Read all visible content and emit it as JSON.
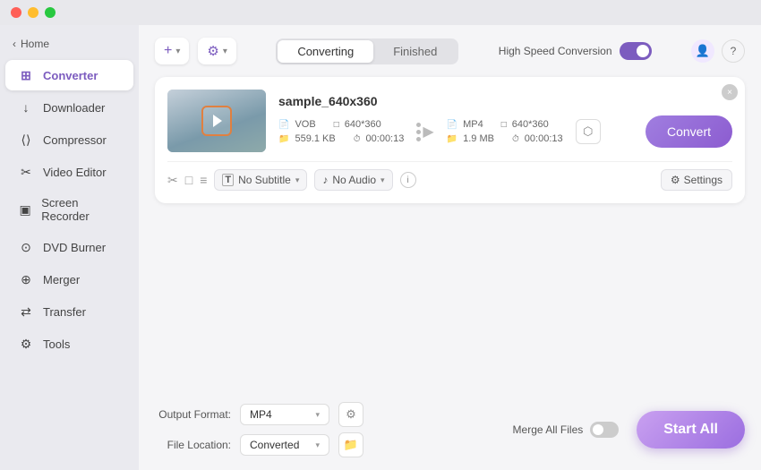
{
  "titleBar": {
    "trafficLights": [
      "red",
      "yellow",
      "green"
    ]
  },
  "sidebar": {
    "homeLabel": "Home",
    "items": [
      {
        "id": "converter",
        "label": "Converter",
        "icon": "⊞",
        "active": true
      },
      {
        "id": "downloader",
        "label": "Downloader",
        "icon": "↓",
        "active": false
      },
      {
        "id": "compressor",
        "label": "Compressor",
        "icon": "⟨⟩",
        "active": false
      },
      {
        "id": "video-editor",
        "label": "Video Editor",
        "icon": "✂",
        "active": false
      },
      {
        "id": "screen-recorder",
        "label": "Screen Recorder",
        "icon": "▣",
        "active": false
      },
      {
        "id": "dvd-burner",
        "label": "DVD Burner",
        "icon": "⊙",
        "active": false
      },
      {
        "id": "merger",
        "label": "Merger",
        "icon": "⊕",
        "active": false
      },
      {
        "id": "transfer",
        "label": "Transfer",
        "icon": "⇄",
        "active": false
      },
      {
        "id": "tools",
        "label": "Tools",
        "icon": "⚙",
        "active": false
      }
    ]
  },
  "header": {
    "addButtonLabel": "+",
    "addSettingsLabel": "⚙",
    "tabs": [
      {
        "id": "converting",
        "label": "Converting",
        "active": true
      },
      {
        "id": "finished",
        "label": "Finished",
        "active": false
      }
    ],
    "speedToggle": {
      "label": "High Speed Conversion",
      "enabled": true
    },
    "icons": {
      "user": "👤",
      "help": "?"
    }
  },
  "fileCard": {
    "fileName": "sample_640x360",
    "closeIcon": "×",
    "source": {
      "format": "VOB",
      "resolution": "640*360",
      "fileSize": "559.1 KB",
      "duration": "00:00:13"
    },
    "target": {
      "format": "MP4",
      "resolution": "640*360",
      "fileSize": "1.9 MB",
      "duration": "00:00:13"
    },
    "convertButtonLabel": "Convert",
    "subtitle": {
      "label": "No Subtitle",
      "icon": "T"
    },
    "audio": {
      "label": "No Audio",
      "icon": "♪"
    },
    "infoIcon": "i",
    "settings": {
      "icon": "⚙",
      "label": "Settings"
    },
    "editIcons": [
      "✂",
      "□",
      "≡"
    ]
  },
  "footer": {
    "outputFormat": {
      "label": "Output Format:",
      "value": "MP4",
      "icon": "⚙"
    },
    "fileLocation": {
      "label": "File Location:",
      "value": "Converted",
      "icon": "📁"
    },
    "mergeAllFiles": {
      "label": "Merge All Files",
      "enabled": false
    },
    "startAllButton": "Start All"
  }
}
